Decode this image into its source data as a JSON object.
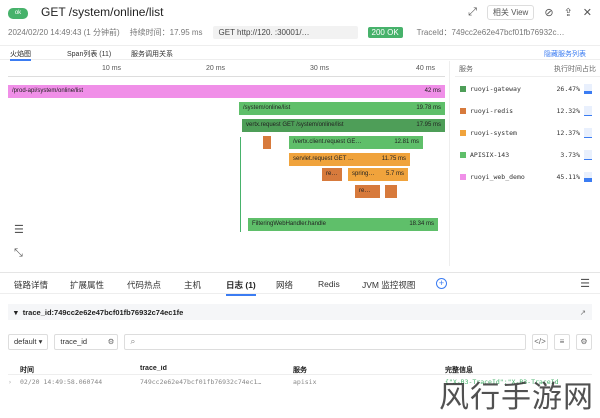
{
  "header": {
    "badge": "ok",
    "title": "GET /system/online/list",
    "view_button": "相关 View",
    "datetime": "2024/02/20 14:49:43 (1 分钟前)",
    "duration": "持续时间：17.95 ms",
    "method_url": "GET  http://120.           :30001/…",
    "status": "200 OK",
    "trace_meta": "TraceId：749cc2e62e47bcf01fb76932c…"
  },
  "top_tabs": {
    "flame": "火焰图",
    "span_list": "Span列表 (11)",
    "service_rel": "服务调用关系",
    "hide_services": "隐藏服务列表"
  },
  "ruler": {
    "t10": "10 ms",
    "t20": "20 ms",
    "t30": "30 ms",
    "t40": "40 ms"
  },
  "bars": {
    "root": {
      "label": "/prod-api/system/online/list",
      "dur": "42 ms",
      "color": "#f08fe8"
    },
    "b1": {
      "label": "/system/online/list",
      "dur": "19.78 ms",
      "color": "#5fbf6a"
    },
    "b2": {
      "label": "vertx.request GET /system/online/list",
      "dur": "17.95 ms",
      "color": "#4e9e58"
    },
    "b3": {
      "label": "/vertx.client.request GE…",
      "dur": "12.81 ms",
      "color": "#5fbf6a"
    },
    "b4": {
      "label": "servlet.request GET …",
      "dur": "11.75 ms",
      "color": "#f0a33c"
    },
    "b5": {
      "label": "re…",
      "dur": "",
      "color": "#d77a3c"
    },
    "b6": {
      "label": "spring…",
      "dur": "5.7 ms",
      "color": "#f0a33c"
    },
    "b7": {
      "label": "re…",
      "dur": "",
      "color": "#d77a3c"
    },
    "b8": {
      "label": "FilteringWebHandler.handle",
      "dur": "18.34 ms",
      "color": "#5fbf6a"
    }
  },
  "services": {
    "col_service": "服务",
    "col_pct": "执行时间占比",
    "items": [
      {
        "name": "ruoyi-gateway",
        "pct": "26.47%",
        "color": "#4e9e58",
        "fill": 0.26
      },
      {
        "name": "ruoyi-redis",
        "pct": "12.32%",
        "color": "#d77a3c",
        "fill": 0.12
      },
      {
        "name": "ruoyi-system",
        "pct": "12.37%",
        "color": "#f0a33c",
        "fill": 0.12
      },
      {
        "name": "APISIX-143",
        "pct": "3.73%",
        "color": "#5fbf6a",
        "fill": 0.04
      },
      {
        "name": "ruoyi_web_demo",
        "pct": "45.11%",
        "color": "#f08fe8",
        "fill": 0.45
      }
    ]
  },
  "bottom_tabs": [
    "链路详情",
    "扩展属性",
    "代码热点",
    "主机",
    "日志 (1)",
    "网络",
    "Redis",
    "JVM 监控视图"
  ],
  "trace_id_row": "trace_id:749cc2e62e47bcf01fb76932c74ec1fe",
  "filter": {
    "select": "default",
    "field": "trace_id"
  },
  "table": {
    "headers": [
      "时间",
      "trace_id",
      "服务",
      "完整信息"
    ],
    "rows": [
      [
        "02/20 14:49:58.060744",
        "749cc2e62e47bcf01fb76932c74ec1…",
        "apisix",
        "{\"X-B3-TraceId\":\"X-B3-TraceId"
      ]
    ]
  },
  "watermark": "风行手游网"
}
